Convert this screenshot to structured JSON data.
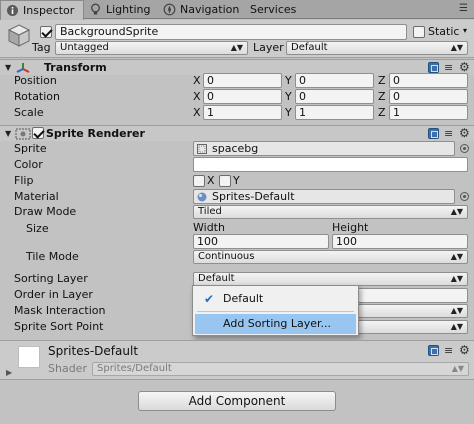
{
  "tabs": [
    {
      "label": "Inspector",
      "icon": "info-icon"
    },
    {
      "label": "Lighting",
      "icon": "bulb-icon"
    },
    {
      "label": "Navigation",
      "icon": "compass-icon"
    },
    {
      "label": "Services",
      "icon": ""
    }
  ],
  "header": {
    "object_name": "BackgroundSprite",
    "active": true,
    "static_label": "Static",
    "static_checked": false,
    "tag_label": "Tag",
    "tag_value": "Untagged",
    "layer_label": "Layer",
    "layer_value": "Default"
  },
  "transform": {
    "title": "Transform",
    "rows": [
      {
        "label": "Position",
        "x": "0",
        "y": "0",
        "z": "0"
      },
      {
        "label": "Rotation",
        "x": "0",
        "y": "0",
        "z": "0"
      },
      {
        "label": "Scale",
        "x": "1",
        "y": "1",
        "z": "1"
      }
    ],
    "axis_labels": [
      "X",
      "Y",
      "Z"
    ]
  },
  "sprite_renderer": {
    "title": "Sprite Renderer",
    "enabled": true,
    "sprite_label": "Sprite",
    "sprite_value": "spacebg",
    "color_label": "Color",
    "color_value": "#ffffff",
    "flip_label": "Flip",
    "flip_x_label": "X",
    "flip_y_label": "Y",
    "flip_x": false,
    "flip_y": false,
    "material_label": "Material",
    "material_value": "Sprites-Default",
    "draw_mode_label": "Draw Mode",
    "draw_mode_value": "Tiled",
    "size_label": "Size",
    "width_label": "Width",
    "height_label": "Height",
    "width_value": "100",
    "height_value": "100",
    "tile_mode_label": "Tile Mode",
    "tile_mode_value": "Continuous",
    "sorting_layer_label": "Sorting Layer",
    "sorting_layer_value": "Default",
    "order_label": "Order in Layer",
    "mask_label": "Mask Interaction",
    "sort_point_label": "Sprite Sort Point"
  },
  "popup": {
    "items": [
      {
        "label": "Default",
        "checked": true
      },
      {
        "label": "Add Sorting Layer...",
        "checked": false
      }
    ]
  },
  "material_footer": {
    "name": "Sprites-Default",
    "shader_label": "Shader",
    "shader_value": "Sprites/Default"
  },
  "add_component_label": "Add Component",
  "colors": {
    "panel_bg": "#c2c2c2",
    "selection": "#99c6f0",
    "accent": "#3d6fa8"
  }
}
